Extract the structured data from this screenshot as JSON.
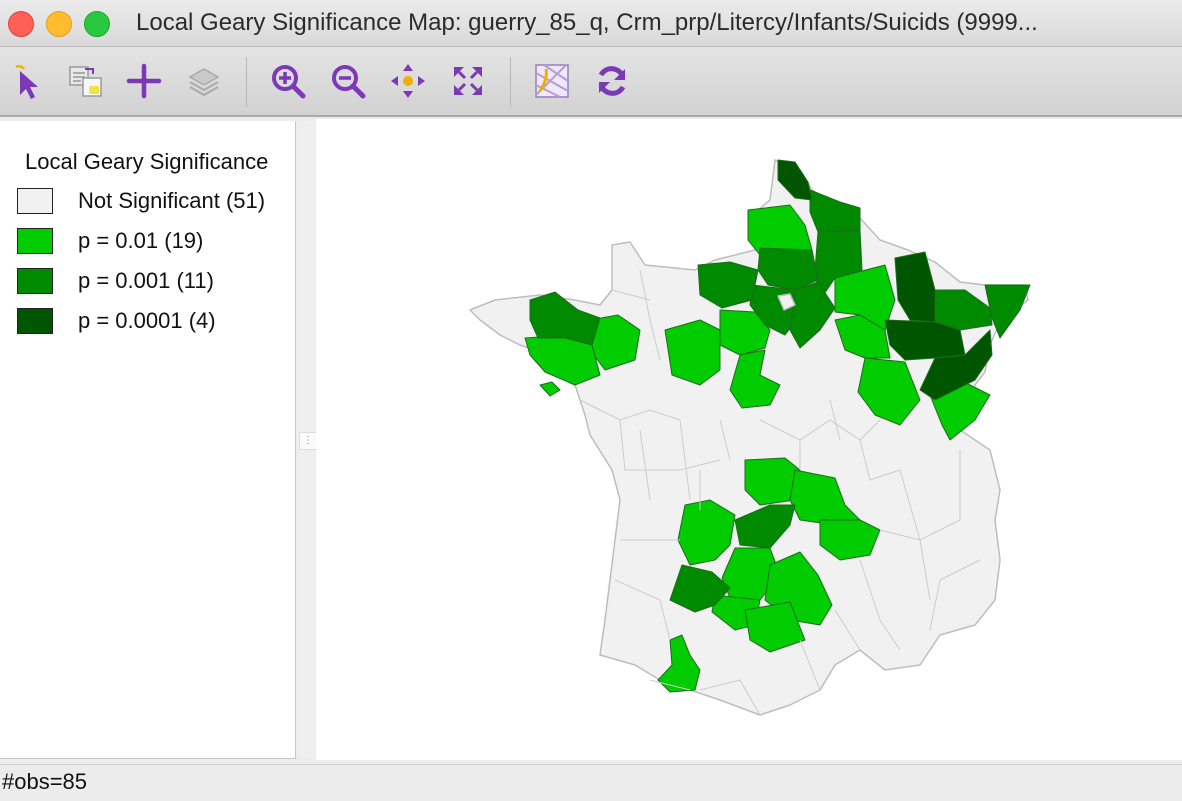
{
  "window": {
    "title": "Local Geary Significance Map: guerry_85_q, Crm_prp/Litercy/Infants/Suicids (9999..."
  },
  "toolbar": {
    "icons": [
      "select-icon",
      "copy-map-icon",
      "add-layer-icon",
      "layers-icon",
      "zoom-in-icon",
      "zoom-out-icon",
      "pan-icon",
      "fit-extent-icon",
      "basemap-icon",
      "refresh-icon"
    ]
  },
  "legend": {
    "title": "Local Geary Significance",
    "items": [
      {
        "label": "Not Significant (51)",
        "color": "#f1f1f1",
        "category": "Not Significant",
        "count": 51
      },
      {
        "label": "p = 0.01 (19)",
        "color": "#00cc00",
        "category": "p = 0.01",
        "count": 19
      },
      {
        "label": "p = 0.001 (11)",
        "color": "#008a00",
        "category": "p = 0.001",
        "count": 11
      },
      {
        "label": "p = 0.0001 (4)",
        "color": "#005500",
        "category": "p = 0.0001",
        "count": 4
      }
    ]
  },
  "colors": {
    "boundary": "#bdbdbd",
    "not_significant": "#f1f1f1",
    "p01": "#00cc00",
    "p001": "#008a00",
    "p0001": "#005500"
  },
  "status": {
    "text": "#obs=85"
  }
}
